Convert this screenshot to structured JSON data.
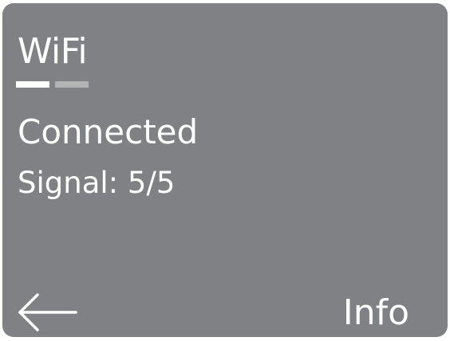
{
  "header": {
    "title": "WiFi",
    "pages": [
      {
        "state": "active"
      },
      {
        "state": "inactive"
      }
    ]
  },
  "main": {
    "status": "Connected",
    "signal": "Signal: 5/5"
  },
  "footer": {
    "back_icon": "arrow-left-icon",
    "info_label": "Info"
  },
  "colors": {
    "background": "#808184",
    "text": "#ffffff",
    "indicator_active": "#ffffff",
    "indicator_inactive": "#b2b3b5"
  }
}
